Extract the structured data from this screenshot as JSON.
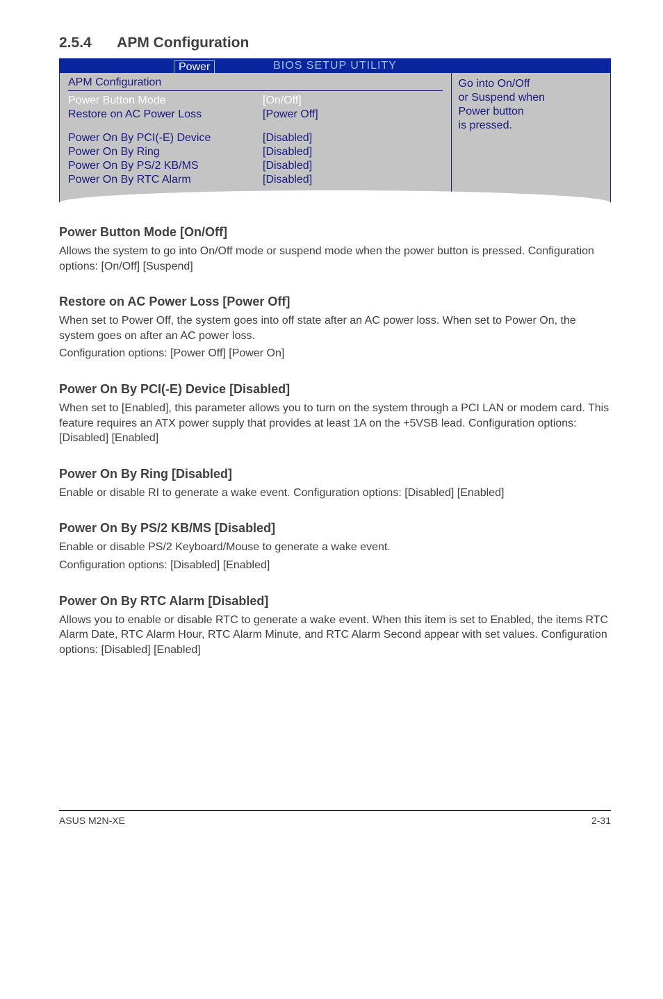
{
  "section": {
    "number": "2.5.4",
    "title": "APM Configuration"
  },
  "bios": {
    "titlebar": "BIOS SETUP UTILITY",
    "tab": "Power",
    "config_heading": "APM Configuration",
    "options": [
      {
        "label": "Power Button Mode",
        "value": "[On/Off]",
        "selected": true
      },
      {
        "label": "Restore on AC Power Loss",
        "value": "[Power Off]",
        "selected": false
      }
    ],
    "options_group2": [
      {
        "label": "Power On By PCI(-E) Device",
        "value": "[Disabled]"
      },
      {
        "label": "Power On By Ring",
        "value": "[Disabled]"
      },
      {
        "label": "Power On By PS/2 KB/MS",
        "value": "[Disabled]"
      },
      {
        "label": "Power On By RTC Alarm",
        "value": "[Disabled]"
      }
    ],
    "help": {
      "line1": "Go into  On/Off",
      "line2": "or Suspend when",
      "line3": "Power button",
      "line4": "is pressed."
    }
  },
  "sections": {
    "pbm": {
      "heading": "Power Button Mode [On/Off]",
      "p1": "Allows the system to go into On/Off mode or suspend mode when the power button is pressed. Configuration options: [On/Off] [Suspend]"
    },
    "racpl": {
      "heading": "Restore on AC Power Loss [Power Off]",
      "p1": "When set to Power Off, the system goes into off state after an AC power loss. When set to Power On, the system goes on after an AC power loss.",
      "p2": "Configuration options: [Power Off] [Power On]"
    },
    "pcie": {
      "heading": "Power On By PCI(-E) Device [Disabled]",
      "p1": "When set to [Enabled], this parameter allows you to turn on the system through a PCI LAN or modem card. This feature requires an ATX power supply that provides at least 1A on the +5VSB lead. Configuration options: [Disabled] [Enabled]"
    },
    "ring": {
      "heading": "Power On By Ring [Disabled]",
      "p1": "Enable or disable RI to generate a wake event. Configuration options: [Disabled] [Enabled]"
    },
    "ps2": {
      "heading": "Power On By PS/2 KB/MS [Disabled]",
      "p1": "Enable or disable PS/2 Keyboard/Mouse to generate a wake event.",
      "p2": "Configuration options: [Disabled] [Enabled]"
    },
    "rtc": {
      "heading": "Power On By RTC Alarm [Disabled]",
      "p1": "Allows you to enable or disable RTC to generate a wake event. When this item is set to Enabled, the items RTC Alarm Date, RTC Alarm Hour, RTC Alarm Minute, and RTC Alarm Second appear with set values. Configuration options: [Disabled] [Enabled]"
    }
  },
  "footer": {
    "left": "ASUS M2N-XE",
    "right": "2-31"
  }
}
